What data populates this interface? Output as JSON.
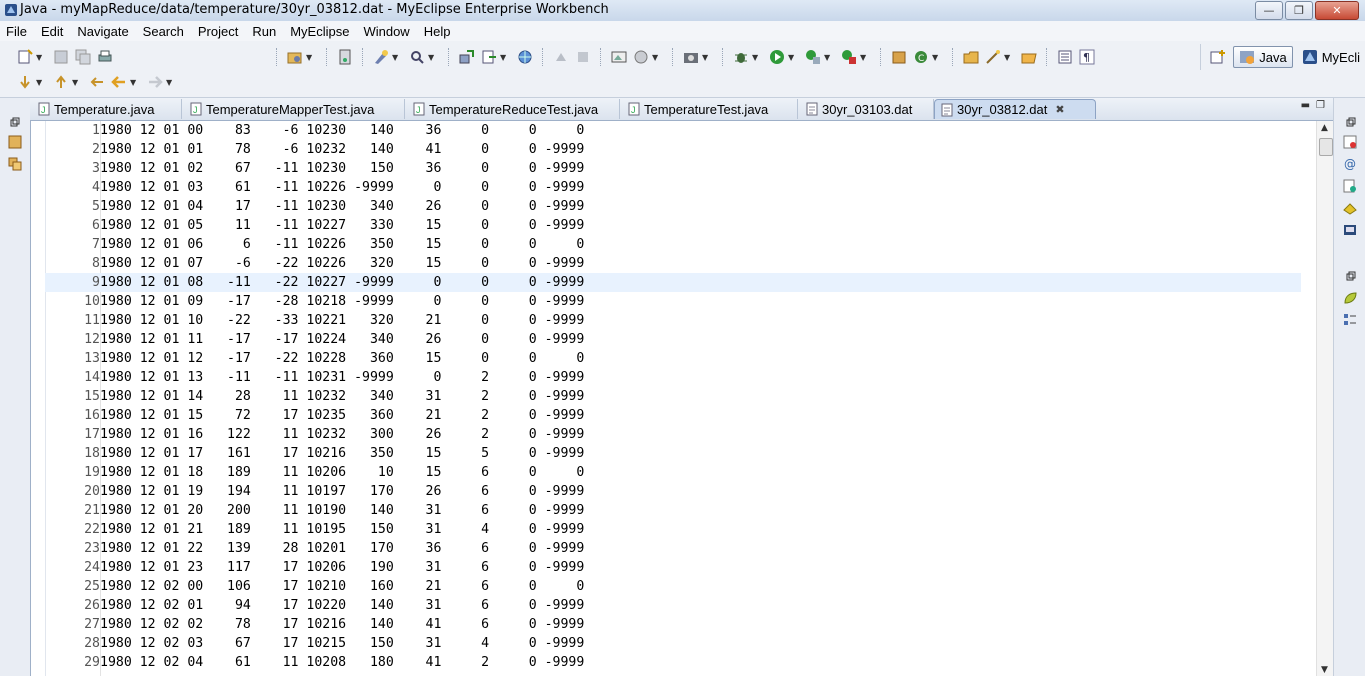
{
  "window": {
    "title": "Java - myMapReduce/data/temperature/30yr_03812.dat - MyEclipse Enterprise Workbench",
    "minimize_icon": "minimize-icon",
    "maximize_icon": "maximize-icon",
    "close_icon": "close-icon"
  },
  "menu": [
    "File",
    "Edit",
    "Navigate",
    "Search",
    "Project",
    "Run",
    "MyEclipse",
    "Window",
    "Help"
  ],
  "perspectives": {
    "java_label": "Java",
    "myeclipse_label": "MyEcli"
  },
  "tabs": [
    {
      "label": "Temperature.java"
    },
    {
      "label": "TemperatureMapperTest.java"
    },
    {
      "label": "TemperatureReduceTest.java"
    },
    {
      "label": "TemperatureTest.java"
    },
    {
      "label": "30yr_03103.dat"
    },
    {
      "label": "30yr_03812.dat"
    }
  ],
  "editor": {
    "current_line": 9,
    "lines": [
      "1980 12 01 00    83    -6 10230   140    36     0     0     0",
      "1980 12 01 01    78    -6 10232   140    41     0     0 -9999",
      "1980 12 01 02    67   -11 10230   150    36     0     0 -9999",
      "1980 12 01 03    61   -11 10226 -9999     0     0     0 -9999",
      "1980 12 01 04    17   -11 10230   340    26     0     0 -9999",
      "1980 12 01 05    11   -11 10227   330    15     0     0 -9999",
      "1980 12 01 06     6   -11 10226   350    15     0     0     0",
      "1980 12 01 07    -6   -22 10226   320    15     0     0 -9999",
      "1980 12 01 08   -11   -22 10227 -9999     0     0     0 -9999",
      "1980 12 01 09   -17   -28 10218 -9999     0     0     0 -9999",
      "1980 12 01 10   -22   -33 10221   320    21     0     0 -9999",
      "1980 12 01 11   -17   -17 10224   340    26     0     0 -9999",
      "1980 12 01 12   -17   -22 10228   360    15     0     0     0",
      "1980 12 01 13   -11   -11 10231 -9999     0     2     0 -9999",
      "1980 12 01 14    28    11 10232   340    31     2     0 -9999",
      "1980 12 01 15    72    17 10235   360    21     2     0 -9999",
      "1980 12 01 16   122    11 10232   300    26     2     0 -9999",
      "1980 12 01 17   161    17 10216   350    15     5     0 -9999",
      "1980 12 01 18   189    11 10206    10    15     6     0     0",
      "1980 12 01 19   194    11 10197   170    26     6     0 -9999",
      "1980 12 01 20   200    11 10190   140    31     6     0 -9999",
      "1980 12 01 21   189    11 10195   150    31     4     0 -9999",
      "1980 12 01 22   139    28 10201   170    36     6     0 -9999",
      "1980 12 01 23   117    17 10206   190    31     6     0 -9999",
      "1980 12 02 00   106    17 10210   160    21     6     0     0",
      "1980 12 02 01    94    17 10220   140    31     6     0 -9999",
      "1980 12 02 02    78    17 10216   140    41     6     0 -9999",
      "1980 12 02 03    67    17 10215   150    31     4     0 -9999",
      "1980 12 02 04    61    11 10208   180    41     2     0 -9999"
    ]
  }
}
